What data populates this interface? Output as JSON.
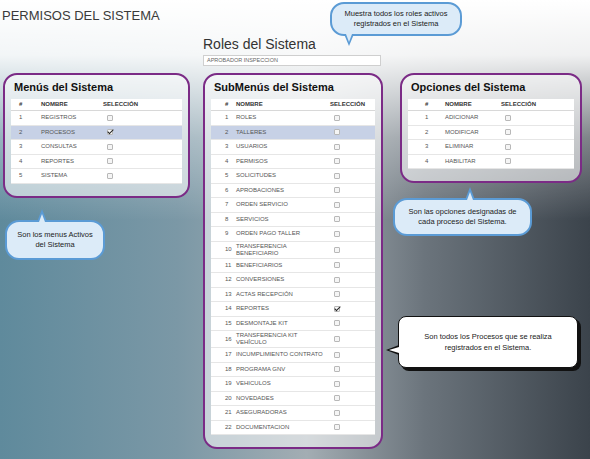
{
  "title": "PERMISOS DEL SISTEMA",
  "roles": {
    "label": "Roles del Sistema",
    "value": "APROBADOR INSPECCION"
  },
  "panels": {
    "menus": {
      "title": "Menús del Sistema",
      "columns": [
        "#",
        "NOMBRE",
        "SELECCIÓN"
      ],
      "rows": [
        {
          "num": "1",
          "name": "REGISTROS",
          "checked": false,
          "selected": false
        },
        {
          "num": "2",
          "name": "PROCESOS",
          "checked": true,
          "selected": true
        },
        {
          "num": "3",
          "name": "CONSULTAS",
          "checked": false,
          "selected": false
        },
        {
          "num": "4",
          "name": "REPORTES",
          "checked": false,
          "selected": false
        },
        {
          "num": "5",
          "name": "SISTEMA",
          "checked": false,
          "selected": false
        }
      ]
    },
    "submenus": {
      "title": "SubMenús del Sistema",
      "columns": [
        "#",
        "NOMBRE",
        "SELECCIÓN"
      ],
      "rows": [
        {
          "num": "1",
          "name": "ROLES",
          "checked": false,
          "selected": false
        },
        {
          "num": "2",
          "name": "TALLERES",
          "checked": false,
          "selected": true
        },
        {
          "num": "3",
          "name": "USUARIOS",
          "checked": false,
          "selected": false
        },
        {
          "num": "4",
          "name": "PERMISOS",
          "checked": false,
          "selected": false
        },
        {
          "num": "5",
          "name": "SOLICITUDES",
          "checked": false,
          "selected": false
        },
        {
          "num": "6",
          "name": "APROBACIONES",
          "checked": false,
          "selected": false
        },
        {
          "num": "7",
          "name": "ORDEN SERVICIO",
          "checked": false,
          "selected": false
        },
        {
          "num": "8",
          "name": "SERVICIOS",
          "checked": false,
          "selected": false
        },
        {
          "num": "9",
          "name": "ORDEN PAGO TALLER",
          "checked": false,
          "selected": false
        },
        {
          "num": "10",
          "name": "TRANSFERENCIA BENEFICIARIO",
          "checked": false,
          "selected": false
        },
        {
          "num": "11",
          "name": "BENEFICIARIOS",
          "checked": false,
          "selected": false
        },
        {
          "num": "12",
          "name": "CONVERSIONES",
          "checked": false,
          "selected": false
        },
        {
          "num": "13",
          "name": "ACTAS RECEPCIÓN",
          "checked": false,
          "selected": false
        },
        {
          "num": "14",
          "name": "REPORTES",
          "checked": true,
          "selected": false
        },
        {
          "num": "15",
          "name": "DESMONTAJE KIT",
          "checked": false,
          "selected": false
        },
        {
          "num": "16",
          "name": "TRANSFERENCIA KIT VEHÍCULO",
          "checked": false,
          "selected": false
        },
        {
          "num": "17",
          "name": "INCUMPLIMIENTO CONTRATO",
          "checked": false,
          "selected": false
        },
        {
          "num": "18",
          "name": "PROGRAMA GNV",
          "checked": false,
          "selected": false
        },
        {
          "num": "19",
          "name": "VEHICULOS",
          "checked": false,
          "selected": false
        },
        {
          "num": "20",
          "name": "NOVEDADES",
          "checked": false,
          "selected": false
        },
        {
          "num": "21",
          "name": "ASEGURADORAS",
          "checked": false,
          "selected": false
        },
        {
          "num": "22",
          "name": "DOCUMENTACION",
          "checked": false,
          "selected": false
        }
      ]
    },
    "opciones": {
      "title": "Opciones del Sistema",
      "columns": [
        "#",
        "NOMBRE",
        "SELECCIÓN"
      ],
      "rows": [
        {
          "num": "1",
          "name": "ADICIONAR",
          "checked": false,
          "selected": false
        },
        {
          "num": "2",
          "name": "MODIFICAR",
          "checked": false,
          "selected": false
        },
        {
          "num": "3",
          "name": "ELIMINAR",
          "checked": false,
          "selected": false
        },
        {
          "num": "4",
          "name": "HABILITAR",
          "checked": false,
          "selected": false
        }
      ]
    }
  },
  "callouts": {
    "roles": {
      "text": "Muestra todos los roles activos registrados en el Sistema",
      "kind": "bubble"
    },
    "menus": {
      "text": "Son los menus Activos del Sistema",
      "kind": "bubble"
    },
    "opciones": {
      "text": "Son las opciones designadas de cada proceso del Sistema.",
      "kind": "bubble"
    },
    "procesos": {
      "text": "Son todos los Procesos que se realiza registrados en el Sistema.",
      "kind": "box"
    }
  }
}
